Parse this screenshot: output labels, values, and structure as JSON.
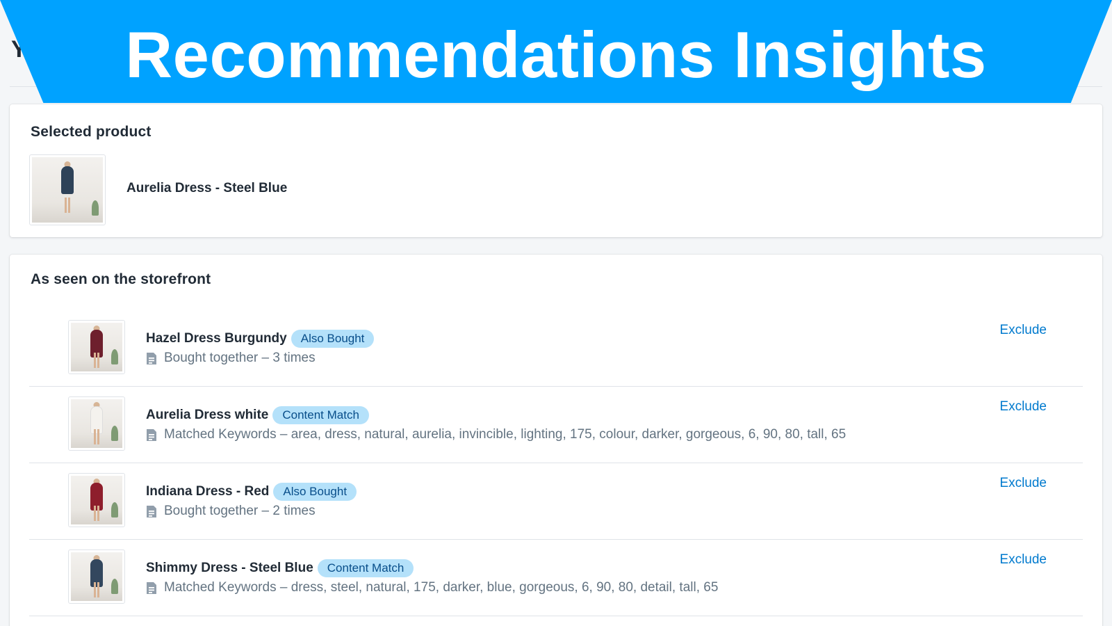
{
  "page": {
    "peek_title": "Y",
    "banner_title": "Recommendations Insights"
  },
  "selected_card": {
    "heading": "Selected product",
    "product_name": "Aurelia Dress - Steel Blue"
  },
  "storefront_card": {
    "heading": "As seen on the storefront",
    "exclude_label": "Exclude",
    "items": [
      {
        "name": "Hazel Dress Burgundy",
        "badge": "Also Bought",
        "detail": "Bought together – 3 times",
        "dress_color": "#6e1f2d"
      },
      {
        "name": "Aurelia Dress white",
        "badge": "Content Match",
        "detail": "Matched Keywords – area, dress, natural, aurelia, invincible, lighting, 175, colour, darker, gorgeous, 6, 90, 80, tall, 65",
        "dress_color": "#f4f2ee"
      },
      {
        "name": "Indiana Dress - Red",
        "badge": "Also Bought",
        "detail": "Bought together – 2 times",
        "dress_color": "#8e1e2c"
      },
      {
        "name": "Shimmy Dress - Steel Blue",
        "badge": "Content Match",
        "detail": "Matched Keywords – dress, steel, natural, 175, darker, blue, gorgeous, 6, 90, 80, detail, tall, 65",
        "dress_color": "#33475e"
      }
    ]
  },
  "colors": {
    "banner": "#00a2ff",
    "link": "#007ace",
    "badge_bg": "#b4e1fa",
    "selected_dress": "#2e4258"
  },
  "icons": {
    "detail_icon": "document-icon"
  }
}
